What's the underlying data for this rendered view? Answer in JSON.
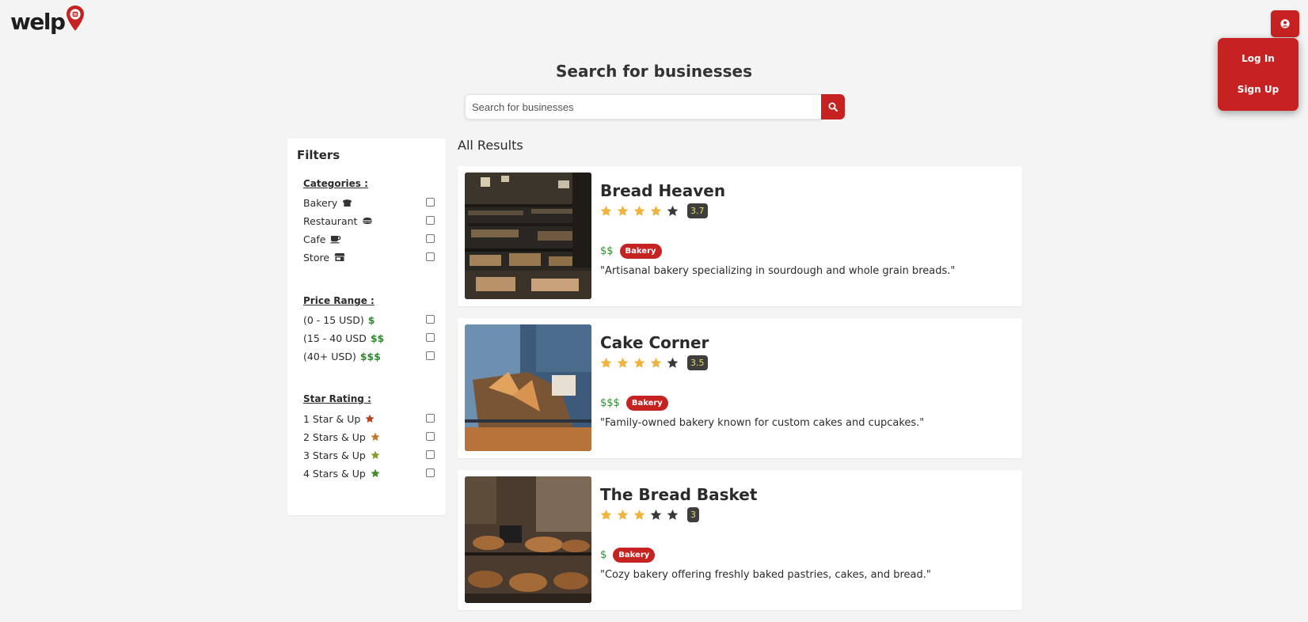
{
  "brand": {
    "name": "welp",
    "accent": "#c62222"
  },
  "auth": {
    "login": "Log In",
    "signup": "Sign Up",
    "user_icon": "user-circle-icon"
  },
  "search": {
    "title": "Search for businesses",
    "placeholder": "Search for businesses",
    "icon": "search-icon"
  },
  "filters": {
    "title": "Filters",
    "categories": {
      "heading": "Categories :",
      "items": [
        {
          "label": "Bakery",
          "icon": "bread-icon"
        },
        {
          "label": "Restaurant",
          "icon": "burger-icon"
        },
        {
          "label": "Cafe",
          "icon": "coffee-icon"
        },
        {
          "label": "Store",
          "icon": "store-icon"
        }
      ]
    },
    "price": {
      "heading": "Price Range :",
      "items": [
        {
          "label": "(0 - 15 USD)",
          "symbol": "$"
        },
        {
          "label": "(15 - 40 USD",
          "symbol": "$$"
        },
        {
          "label": "(40+ USD)",
          "symbol": "$$$"
        }
      ]
    },
    "stars": {
      "heading": "Star Rating :",
      "items": [
        {
          "label": "1 Star & Up",
          "color": "#b8401c"
        },
        {
          "label": "2 Stars & Up",
          "color": "#c0782a"
        },
        {
          "label": "3 Stars & Up",
          "color": "#8a9a2c"
        },
        {
          "label": "4 Stars & Up",
          "color": "#3f8a2a"
        }
      ]
    }
  },
  "results": {
    "title": "All Results",
    "items": [
      {
        "name": "Bread Heaven",
        "rating": "3.7",
        "filled_stars": 4,
        "price": "$$",
        "category": "Bakery",
        "description": "\"Artisanal bakery specializing in sourdough and whole grain breads.\""
      },
      {
        "name": "Cake Corner",
        "rating": "3.5",
        "filled_stars": 4,
        "price": "$$$",
        "category": "Bakery",
        "description": "\"Family-owned bakery known for custom cakes and cupcakes.\""
      },
      {
        "name": "The Bread Basket",
        "rating": "3",
        "filled_stars": 3,
        "price": "$",
        "category": "Bakery",
        "description": "\"Cozy bakery offering freshly baked pastries, cakes, and bread.\""
      }
    ]
  }
}
